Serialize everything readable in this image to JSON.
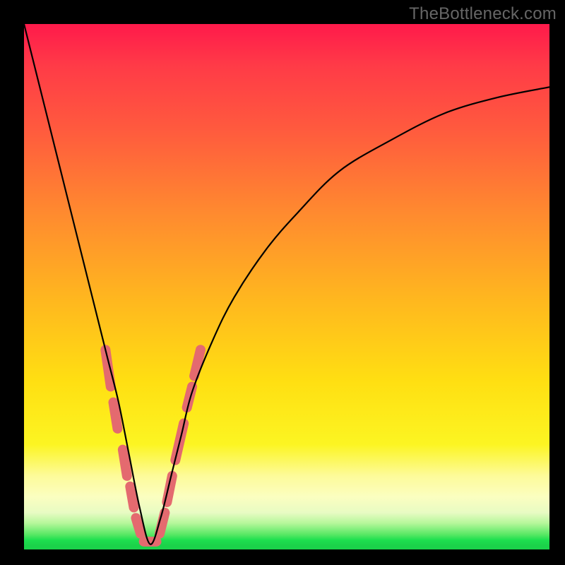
{
  "watermark": "TheBottleneck.com",
  "chart_data": {
    "type": "line",
    "title": "",
    "xlabel": "",
    "ylabel": "",
    "xlim": [
      0,
      100
    ],
    "ylim": [
      0,
      100
    ],
    "grid": false,
    "legend": false,
    "notes": "Bottleneck-style V curve on a vertical red→green gradient. The trough (optimal point) sits at roughly x≈24 on a 0–100 scale. No axes, ticks, or labels are rendered. Pink pill markers cluster along the two walls of the V near the trough.",
    "series": [
      {
        "name": "bottleneck_curve",
        "x": [
          0,
          2,
          4,
          6,
          8,
          10,
          12,
          14,
          16,
          18,
          20,
          22,
          24,
          26,
          28,
          30,
          32,
          36,
          40,
          46,
          52,
          60,
          70,
          80,
          90,
          100
        ],
        "y": [
          100,
          92,
          84,
          76,
          68,
          60,
          52,
          44,
          36,
          28,
          18,
          8,
          1,
          6,
          14,
          22,
          30,
          40,
          48,
          57,
          64,
          72,
          78,
          83,
          86,
          88
        ]
      }
    ],
    "markers": {
      "name": "pill_highlights",
      "description": "Short rounded salmon segments overlaid on the curve near the trough on both walls.",
      "segments": [
        {
          "x0": 15.5,
          "y0": 38,
          "x1": 16.5,
          "y1": 31
        },
        {
          "x0": 17.0,
          "y0": 28,
          "x1": 17.8,
          "y1": 23
        },
        {
          "x0": 18.8,
          "y0": 19,
          "x1": 19.6,
          "y1": 14
        },
        {
          "x0": 20.2,
          "y0": 12,
          "x1": 20.9,
          "y1": 8
        },
        {
          "x0": 21.3,
          "y0": 6,
          "x1": 22.2,
          "y1": 3
        },
        {
          "x0": 22.8,
          "y0": 1.5,
          "x1": 25.2,
          "y1": 1.5
        },
        {
          "x0": 25.8,
          "y0": 3,
          "x1": 26.8,
          "y1": 7
        },
        {
          "x0": 27.2,
          "y0": 9,
          "x1": 28.2,
          "y1": 14
        },
        {
          "x0": 28.8,
          "y0": 17,
          "x1": 30.4,
          "y1": 24
        },
        {
          "x0": 31.0,
          "y0": 27,
          "x1": 32.0,
          "y1": 31
        },
        {
          "x0": 32.4,
          "y0": 33,
          "x1": 33.6,
          "y1": 38
        }
      ]
    },
    "background_gradient_stops": [
      {
        "pos": 0.0,
        "color": "#ff1a4b"
      },
      {
        "pos": 0.2,
        "color": "#ff5a3e"
      },
      {
        "pos": 0.52,
        "color": "#ffdf12"
      },
      {
        "pos": 0.86,
        "color": "#fdfb9a"
      },
      {
        "pos": 0.95,
        "color": "#b5f79a"
      },
      {
        "pos": 0.99,
        "color": "#1bd24a"
      }
    ]
  }
}
